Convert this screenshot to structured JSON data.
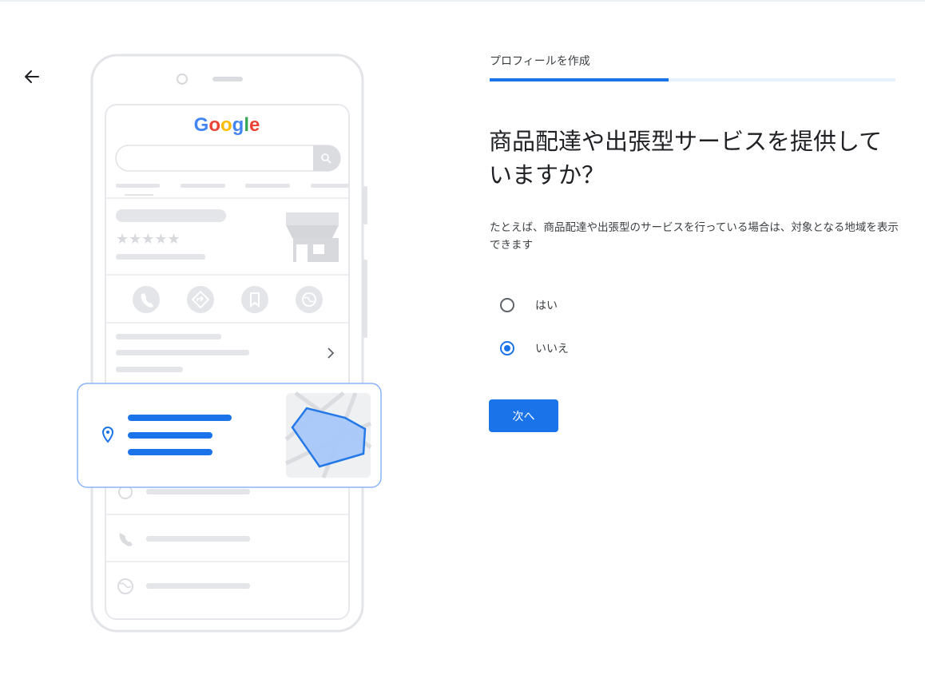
{
  "header": {
    "back_icon": "arrow-left-icon",
    "step_label": "プロフィールを作成",
    "progress": 0.44
  },
  "question": {
    "title": "商品配達や出張型サービスを提供していますか？",
    "description": "たとえば、商品配達や出張型のサービスを行っている場合は、対象となる地域を表示できます"
  },
  "options": [
    {
      "label": "はい",
      "selected": false
    },
    {
      "label": "いいえ",
      "selected": true
    }
  ],
  "actions": {
    "next_label": "次へ"
  },
  "illustration": {
    "logo_text": "Google",
    "colors": {
      "accent": "#1a73e8",
      "area_fill": "#a8c7fa",
      "placeholder": "#e3e5e8",
      "outline": "#dadce0"
    },
    "action_icons": [
      "phone-icon",
      "directions-icon",
      "bookmark-icon",
      "globe-icon"
    ]
  },
  "theme": {
    "primary": "#1a73e8",
    "progress_track": "#e8f0fe",
    "text": "#202124"
  }
}
